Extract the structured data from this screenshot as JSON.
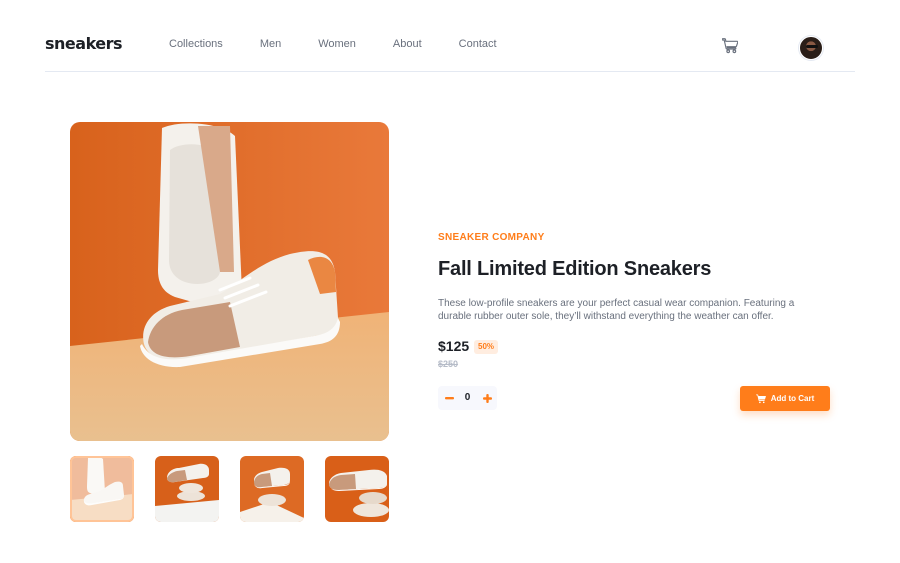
{
  "brand": {
    "logo": "sneakers"
  },
  "nav": {
    "items": [
      {
        "label": "Collections"
      },
      {
        "label": "Men"
      },
      {
        "label": "Women"
      },
      {
        "label": "About"
      },
      {
        "label": "Contact"
      }
    ]
  },
  "header": {
    "cart_icon": "cart-icon",
    "avatar_icon": "user-avatar"
  },
  "product": {
    "company": "SNEAKER COMPANY",
    "title": "Fall Limited Edition Sneakers",
    "description": "These low-profile sneakers are your perfect casual wear companion. Featuring a durable rubber outer sole, they’ll withstand everything the weather can offer.",
    "price": "$125",
    "discount": "50%",
    "old_price": "$250",
    "quantity": "0",
    "minus_icon": "minus-icon",
    "plus_icon": "plus-icon",
    "add_to_cart_label": "Add to Cart"
  },
  "gallery": {
    "thumbnail_count": 4,
    "active_index": 0
  },
  "colors": {
    "accent": "#ff7d1a",
    "accent_pale": "#ffede0",
    "text_dark": "#1d2026",
    "text_muted": "#69707d",
    "text_light": "#b6bcc8"
  }
}
